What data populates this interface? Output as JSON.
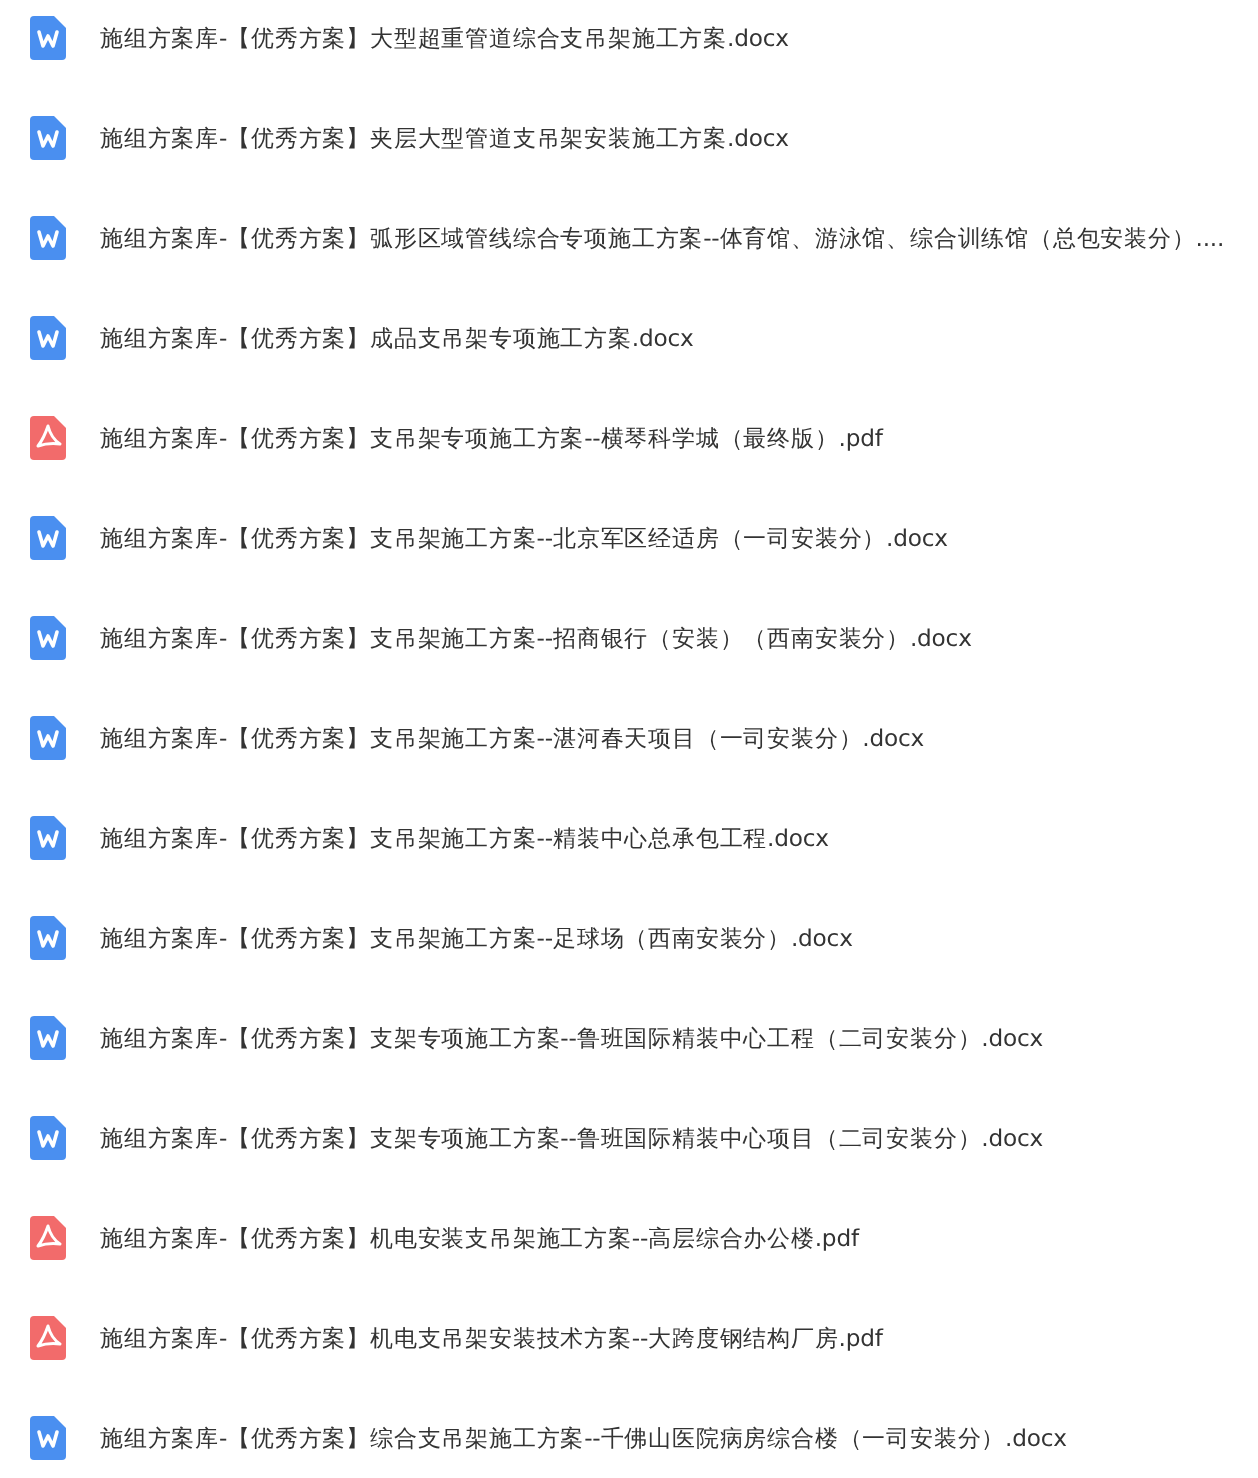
{
  "files": [
    {
      "kind": "docx",
      "name": "施组方案库-【优秀方案】大型超重管道综合支吊架施工方案.docx"
    },
    {
      "kind": "docx",
      "name": "施组方案库-【优秀方案】夹层大型管道支吊架安装施工方案.docx"
    },
    {
      "kind": "docx",
      "name": "施组方案库-【优秀方案】弧形区域管线综合专项施工方案--体育馆、游泳馆、综合训练馆（总包安装分）...."
    },
    {
      "kind": "docx",
      "name": "施组方案库-【优秀方案】成品支吊架专项施工方案.docx"
    },
    {
      "kind": "pdf",
      "name": "施组方案库-【优秀方案】支吊架专项施工方案--横琴科学城（最终版）.pdf"
    },
    {
      "kind": "docx",
      "name": "施组方案库-【优秀方案】支吊架施工方案--北京军区经适房（一司安装分）.docx"
    },
    {
      "kind": "docx",
      "name": "施组方案库-【优秀方案】支吊架施工方案--招商银行（安装）（西南安装分）.docx"
    },
    {
      "kind": "docx",
      "name": "施组方案库-【优秀方案】支吊架施工方案--湛河春天项目（一司安装分）.docx"
    },
    {
      "kind": "docx",
      "name": "施组方案库-【优秀方案】支吊架施工方案--精装中心总承包工程.docx"
    },
    {
      "kind": "docx",
      "name": "施组方案库-【优秀方案】支吊架施工方案--足球场（西南安装分）.docx"
    },
    {
      "kind": "docx",
      "name": "施组方案库-【优秀方案】支架专项施工方案--鲁班国际精装中心工程（二司安装分）.docx"
    },
    {
      "kind": "docx",
      "name": "施组方案库-【优秀方案】支架专项施工方案--鲁班国际精装中心项目（二司安装分）.docx"
    },
    {
      "kind": "pdf",
      "name": "施组方案库-【优秀方案】机电安装支吊架施工方案--高层综合办公楼.pdf"
    },
    {
      "kind": "pdf",
      "name": "施组方案库-【优秀方案】机电支吊架安装技术方案--大跨度钢结构厂房.pdf"
    },
    {
      "kind": "docx",
      "name": "施组方案库-【优秀方案】综合支吊架施工方案--千佛山医院病房综合楼（一司安装分）.docx"
    }
  ]
}
